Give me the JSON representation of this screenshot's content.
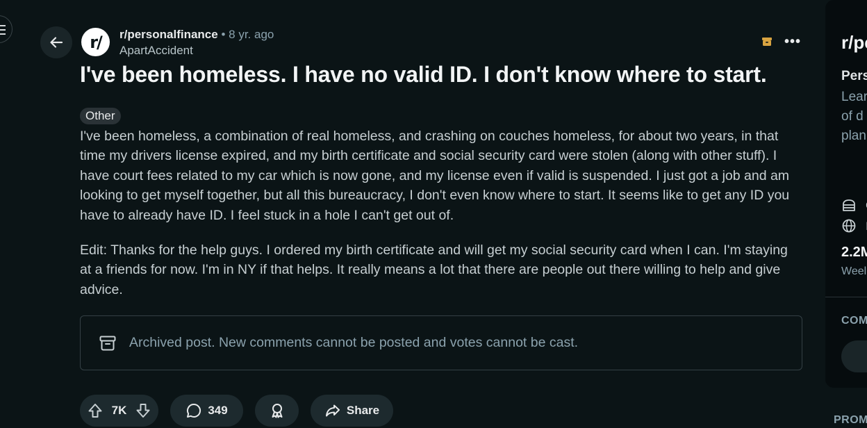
{
  "post": {
    "subreddit": "r/personalfinance",
    "separator": "•",
    "age": "8 yr. ago",
    "author": "ApartAccident",
    "title": "I've been homeless. I have no valid ID. I don't know where to start.",
    "flair": "Other",
    "body_paragraph_1": "I've been homeless, a combination of real homeless, and crashing on couches homeless, for about two years, in that time my drivers license expired, and my birth certificate and social security card were stolen (along with other stuff). I have court fees related to my car which is now gone, and my license even if valid is suspended. I just got a job and am looking to get myself together, but all this bureaucracy, I don't even know where to start. It seems like to get any ID you have to already have ID. I feel stuck in a hole I can't get out of.",
    "body_paragraph_2": "Edit: Thanks for the help guys. I ordered my birth certificate and will get my social security card when I can. I'm staying at a friends for now. I'm in NY if that helps. It really means a lot that there are people out there willing to help and give advice.",
    "archived_notice": "Archived post. New comments cannot be posted and votes cannot be cast."
  },
  "actions": {
    "vote_count": "7K",
    "comment_count": "349",
    "share_label": "Share"
  },
  "sidebar": {
    "title": "r/pe",
    "subtitle": "Pers",
    "desc_line_1": "Lear",
    "desc_line_2": "of d",
    "desc_line_3": "plan",
    "info_1": "C",
    "info_2": "I",
    "stat_value": "2.2M",
    "stat_label": "Weel",
    "section_label": "COM"
  },
  "footer": {
    "promo_label": "PROM"
  },
  "colors": {
    "background": "#0b1416",
    "pill": "#1d2a2e",
    "archive_badge": "#d9a441",
    "muted_text": "#8ba2ad"
  },
  "icons": [
    "menu-icon",
    "back-arrow-icon",
    "subreddit-logo-icon",
    "archive-badge-icon",
    "more-icon",
    "archive-icon",
    "upvote-icon",
    "downvote-icon",
    "comment-icon",
    "award-icon",
    "share-icon",
    "cake-icon",
    "globe-icon"
  ]
}
